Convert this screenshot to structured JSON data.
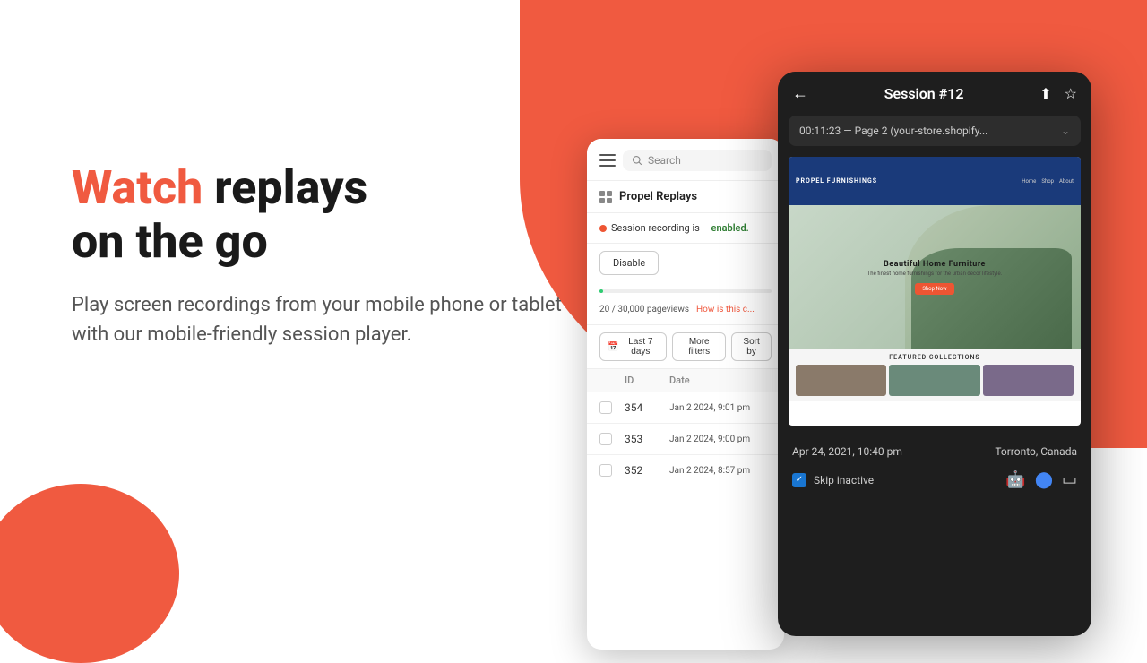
{
  "background": {
    "accent_color": "#F05A40"
  },
  "hero": {
    "watch": "Watch",
    "headline_rest": " replays\non the go",
    "subtitle": "Play screen recordings from your mobile phone or tablet with our mobile-friendly session player."
  },
  "phone_list": {
    "search_placeholder": "Search",
    "app_title": "Propel Replays",
    "recording_label": "Session recording is",
    "recording_status": "enabled.",
    "disable_btn": "Disable",
    "pageviews": "20 / 30,000 pageviews",
    "how_link": "How is this c...",
    "last_7_days": "Last 7 days",
    "more_filters": "More filters",
    "sort_by": "Sort by",
    "col_id": "ID",
    "col_date": "Date",
    "rows": [
      {
        "id": "354",
        "date": "Jan 2 2024, 9:01 pm"
      },
      {
        "id": "353",
        "date": "Jan 2 2024, 9:00 pm"
      },
      {
        "id": "352",
        "date": "Jan 2 2024, 8:57 pm"
      }
    ]
  },
  "phone_player": {
    "title": "Session #12",
    "url": "00:11:23 — Page 2 (your-store.shopify...",
    "store": {
      "name": "PROPEL FURNISHINGS",
      "nav_links": [
        "Home",
        "Shop",
        "About"
      ],
      "hero_title": "Beautiful Home Furniture",
      "hero_subtitle": "The finest home furnishings for the urban décor lifestyle.",
      "hero_cta": "Shop Now",
      "collections_heading": "FEATURED COLLECTIONS"
    },
    "date": "Apr 24, 2021, 10:40 pm",
    "location": "Torronto, Canada",
    "skip_inactive": "Skip inactive"
  }
}
